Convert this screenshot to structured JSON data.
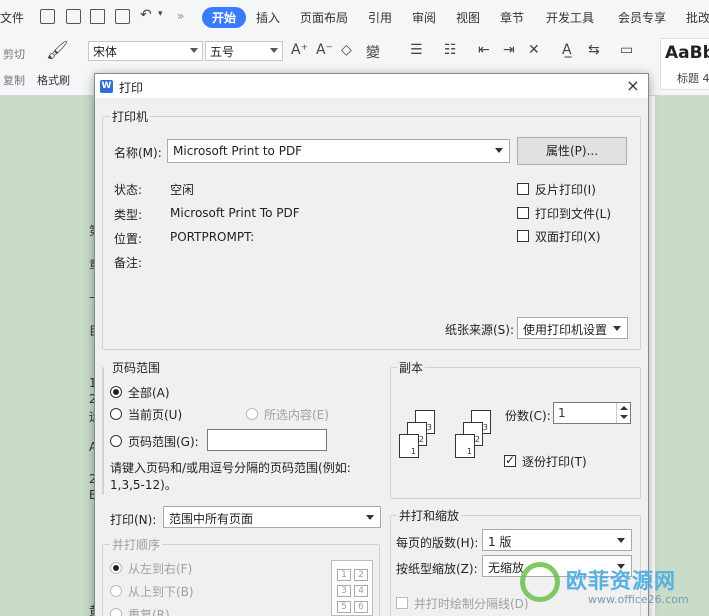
{
  "ribbon": {
    "menu": {
      "file": "文件",
      "start": "开始",
      "insert": "插入",
      "layout": "页面布局",
      "reference": "引用",
      "review": "审阅",
      "view": "视图",
      "chapter": "章节",
      "dev": "开发工具",
      "member": "会员专享",
      "comment": "批改"
    },
    "quick_more": "»",
    "cut": "剪切",
    "copy": "复制",
    "format_painter": "格式刷",
    "font": "宋体",
    "font_size": "五号",
    "style_preview": "AaBb",
    "style_label": "标题 4"
  },
  "doc_fragments": [
    "第",
    "章",
    "—",
    "目",
    "1",
    "2",
    "运",
    "A",
    "2",
    "B",
    "黄"
  ],
  "dialog": {
    "title": "打印",
    "close": "×",
    "printer": {
      "legend": "打印机",
      "name_label": "名称(M):",
      "name_value": "Microsoft Print to PDF",
      "properties": "属性(P)...",
      "status_label": "状态:",
      "status_value": "空闲",
      "type_label": "类型:",
      "type_value": "Microsoft Print To PDF",
      "location_label": "位置:",
      "location_value": "PORTPROMPT:",
      "comment_label": "备注:",
      "reverse": "反片打印(I)",
      "to_file": "打印到文件(L)",
      "duplex": "双面打印(X)",
      "source_label": "纸张来源(S):",
      "source_value": "使用打印机设置"
    },
    "range": {
      "legend": "页码范围",
      "all": "全部(A)",
      "current": "当前页(U)",
      "selection": "所选内容(E)",
      "pages": "页码范围(G):",
      "hint_line1": "请键入页码和/或用逗号分隔的页码范围(例如:",
      "hint_line2": "1,3,5-12)。"
    },
    "copies": {
      "legend": "副本",
      "count_label": "份数(C):",
      "count_value": "1",
      "collate": "逐份打印(T)",
      "sheet_nums": [
        "3",
        "2",
        "1",
        "3",
        "2",
        "1"
      ]
    },
    "print_what": {
      "label": "打印(N):",
      "value": "范围中所有页面"
    },
    "order": {
      "legend": "并打顺序",
      "ltr": "从左到右(F)",
      "ttb": "从上到下(B)",
      "repeat": "重复(R)",
      "grid": [
        "1",
        "2",
        "3",
        "4",
        "5",
        "6"
      ]
    },
    "zoom": {
      "legend": "并打和缩放",
      "per_sheet_label": "每页的版数(H):",
      "per_sheet_value": "1 版",
      "scale_label": "按纸型缩放(Z):",
      "scale_value": "无缩放",
      "draw_lines": "并打时绘制分隔线(D)"
    }
  },
  "watermark": {
    "name": "欧菲资源网",
    "url": "www.office26.com"
  },
  "colors": {
    "accent": "#3a7bff",
    "doc_bg": "#c8dcc8",
    "watermark_green": "#6cc04a",
    "watermark_blue": "#56b0e0"
  }
}
